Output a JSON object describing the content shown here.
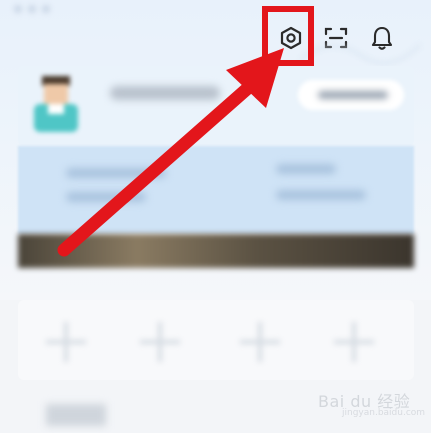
{
  "header": {
    "settings_icon": "settings-icon",
    "scan_icon": "scan-icon",
    "notification_icon": "bell-icon"
  },
  "annotation": {
    "highlight_color": "#e3161b",
    "arrow_color": "#e3161b"
  },
  "watermark": {
    "text": "Bai du 经验",
    "sub": "jingyan.baidu.com"
  },
  "colors": {
    "header_gradient_top": "#e8f1fb",
    "blue_card": "#cfe3f6",
    "icon_stroke": "#2b2b2b"
  }
}
